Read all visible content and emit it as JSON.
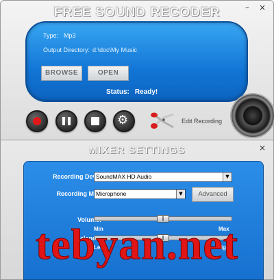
{
  "recorder": {
    "title": "FREE SOUND RECODER",
    "minimize_glyph": "–",
    "close_glyph": "×",
    "type_label": "Type:",
    "type_value": "Mp3",
    "output_label": "Output Directory:",
    "output_value": "d:\\doc\\My Music",
    "browse_label": "BROWSE",
    "open_label": "OPEN",
    "status_label": "Status:",
    "status_value": "Ready!",
    "edit_recording_label": "Edit Recording",
    "controls": [
      "record-icon",
      "pause-icon",
      "stop-icon",
      "gear-icon"
    ]
  },
  "mixer": {
    "title": "MIXER SETTINGS",
    "close_glyph": "×",
    "device_label": "Recording Device:",
    "device_value": "SoundMAX HD Audio",
    "mixer_label": "Recording Mixer:",
    "mixer_value": "Microphone",
    "advanced_label": "Advanced",
    "volume_label": "Volume:",
    "volume_level": 0.5,
    "min_label": "Min",
    "max_label": "Max",
    "balance_label": "Balance:",
    "balance_level": 0.5,
    "left_label": "Left",
    "right_label": "Right"
  },
  "watermark": "tebyan.net",
  "colors": {
    "display_blue": "#1276d6",
    "panel_blue": "#1670cf",
    "record_red": "#e31818",
    "watermark_red": "#e01515"
  }
}
